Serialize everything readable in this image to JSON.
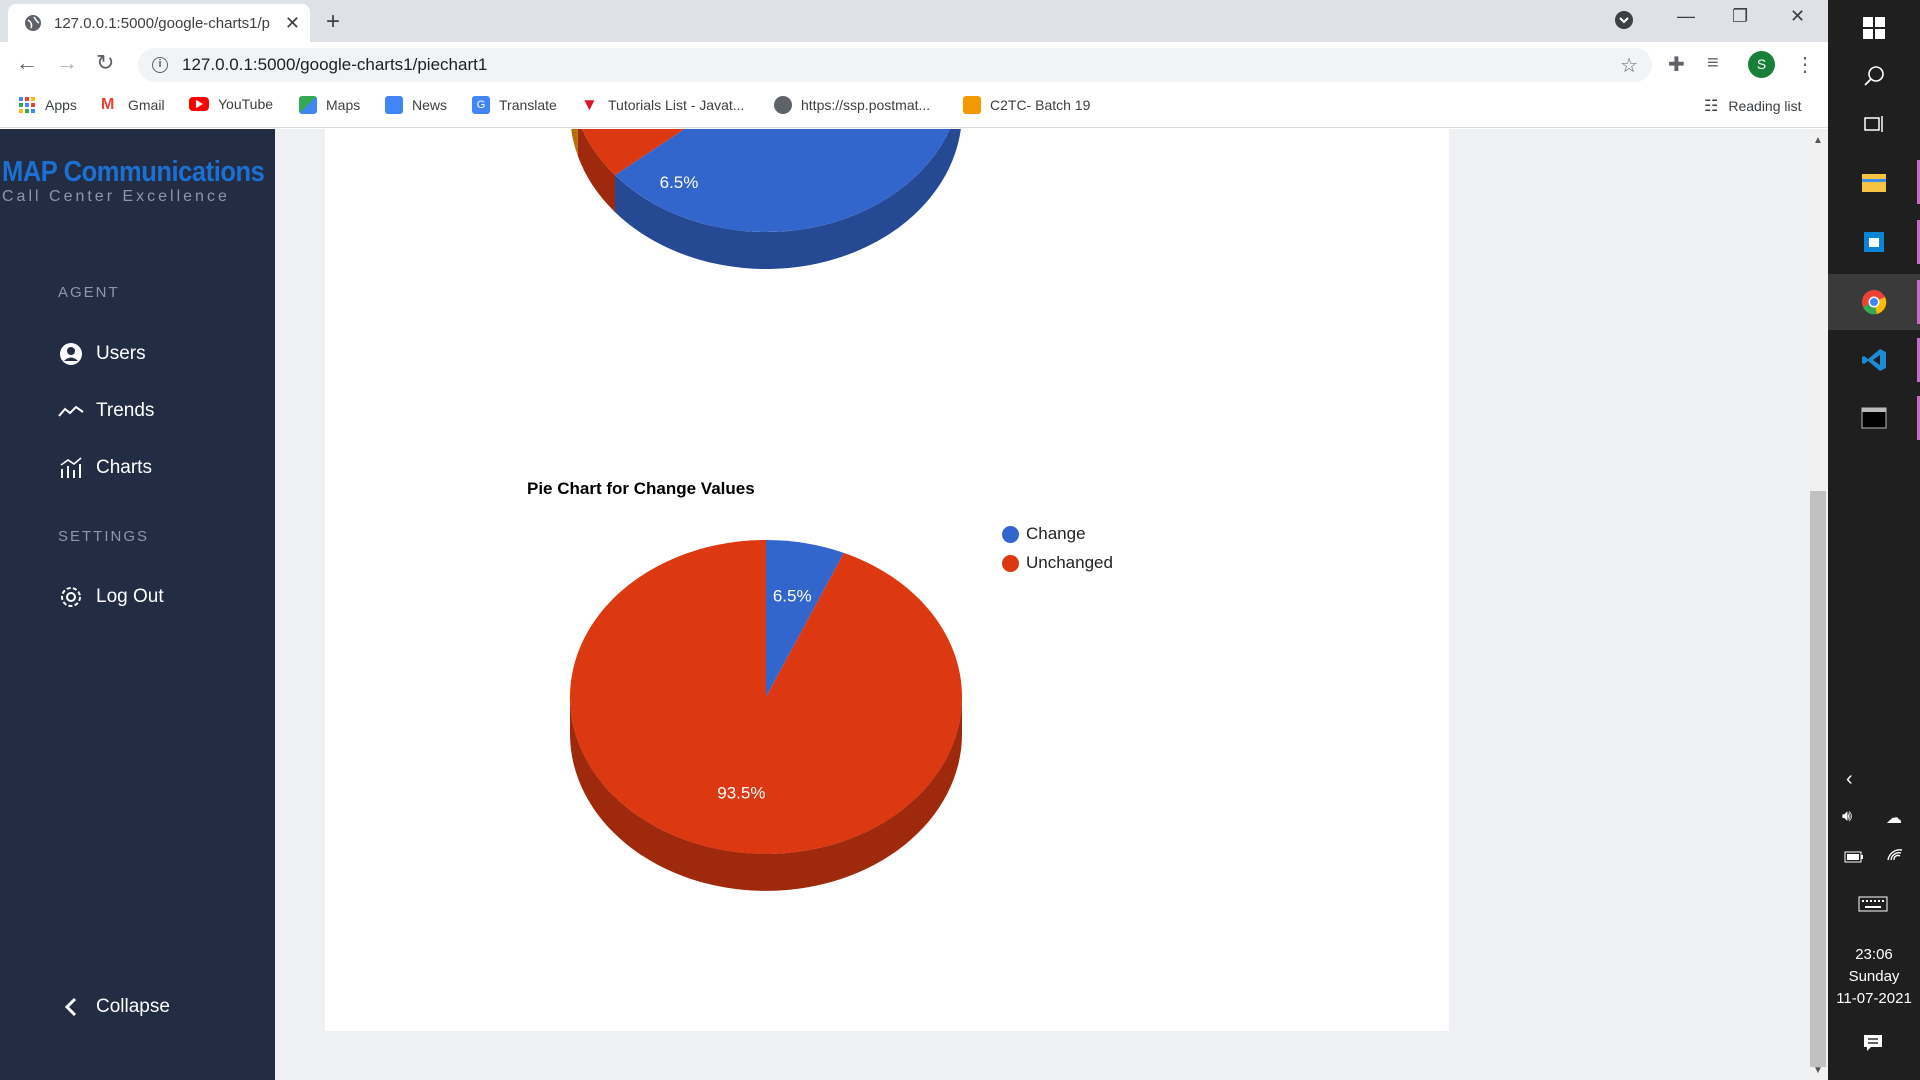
{
  "browser": {
    "tab_title": "127.0.0.1:5000/google-charts1/p",
    "url": "127.0.0.1:5000/google-charts1/piechart1",
    "avatar_letter": "S",
    "bookmarks": [
      "Apps",
      "Gmail",
      "YouTube",
      "Maps",
      "News",
      "Translate",
      "Tutorials List - Javat...",
      "https://ssp.postmat...",
      "C2TC- Batch 19"
    ],
    "reading_list": "Reading list"
  },
  "sidebar": {
    "logo_main": "MAP Communications",
    "logo_sub": "Call Center Excellence",
    "section_agent": "AGENT",
    "section_settings": "SETTINGS",
    "items": [
      {
        "label": "Users",
        "icon": "user-icon"
      },
      {
        "label": "Trends",
        "icon": "trend-icon"
      },
      {
        "label": "Charts",
        "icon": "chart-icon"
      }
    ],
    "logout": "Log Out",
    "collapse": "Collapse"
  },
  "top_chart": {
    "visible_label": "6.5%",
    "colors": {
      "blue": "#3366cc",
      "red": "#dc3912",
      "orange": "#ff9900"
    }
  },
  "chart_data": {
    "type": "pie",
    "title": "Pie Chart for Change Values",
    "is3D": true,
    "categories": [
      "Change",
      "Unchanged"
    ],
    "values": [
      6.5,
      93.5
    ],
    "labels": [
      "6.5%",
      "93.5%"
    ],
    "colors": [
      "#3366cc",
      "#dc3912"
    ],
    "legend_position": "right"
  },
  "taskbar": {
    "time": "23:06",
    "day": "Sunday",
    "date": "11-07-2021"
  }
}
